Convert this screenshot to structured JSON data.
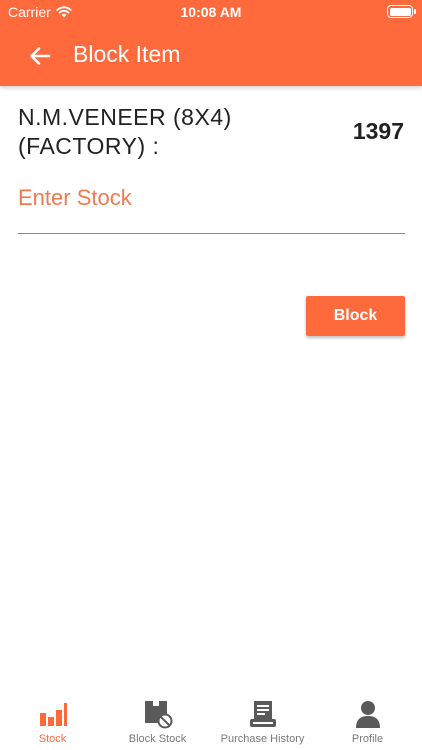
{
  "status_bar": {
    "carrier": "Carrier",
    "time": "10:08 AM"
  },
  "header": {
    "title": "Block Item",
    "back_icon": "arrow-left-icon"
  },
  "item": {
    "name": "N.M.VENEER (8X4) (FACTORY)   :",
    "count": "1397"
  },
  "stock_input": {
    "placeholder": "Enter Stock",
    "value": ""
  },
  "block_button": {
    "label": "Block"
  },
  "tabs": [
    {
      "label": "Stock",
      "icon": "bar-chart-icon",
      "active": true
    },
    {
      "label": "Block Stock",
      "icon": "blocked-box-icon",
      "active": false
    },
    {
      "label": "Purchase History",
      "icon": "receipt-icon",
      "active": false
    },
    {
      "label": "Profile",
      "icon": "person-icon",
      "active": false
    }
  ],
  "colors": {
    "accent": "#ff6a3d",
    "inactive": "#5a5a5a",
    "tab_label": "#7a7a7a"
  }
}
